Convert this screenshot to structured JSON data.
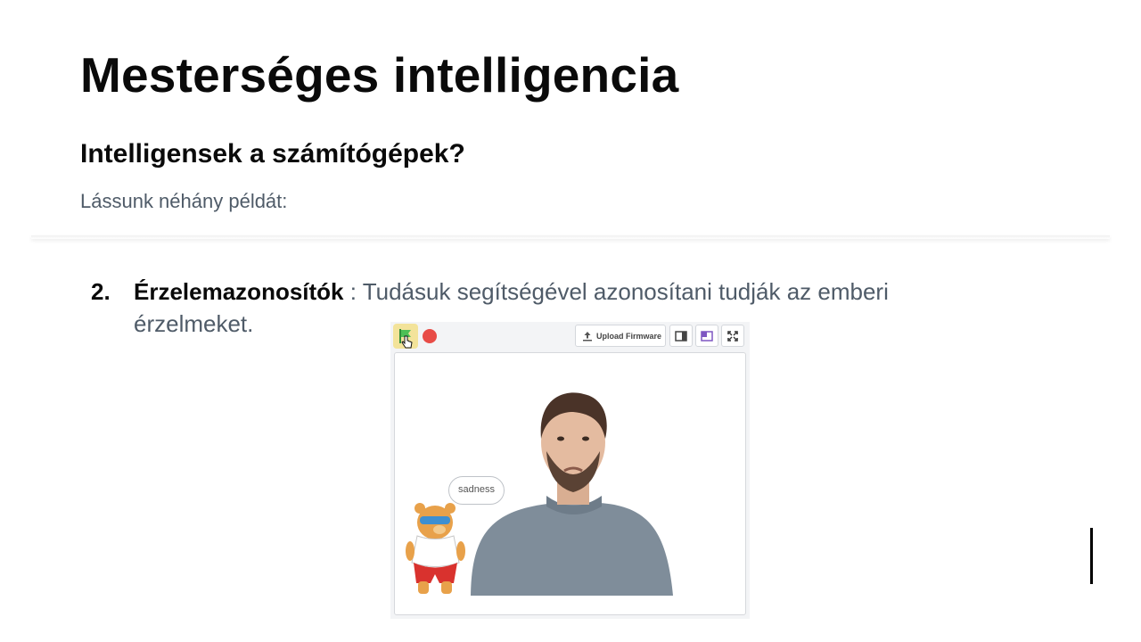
{
  "slide": {
    "title": "Mesterséges intelligencia",
    "subtitle": "Intelligensek a számítógépek?",
    "lead": "Lássunk néhány példát:"
  },
  "item": {
    "number": "2.",
    "term": "Érzelemazonosítók",
    "description": " : Tudásuk segítségével azonosítani tudják az emberi érzelmeket."
  },
  "demo": {
    "toolbar": {
      "upload_label": "Upload Firmware",
      "icons": [
        "green-flag-icon",
        "stop-icon",
        "upload-icon",
        "small-stage-icon",
        "large-stage-icon",
        "fullscreen-icon"
      ]
    },
    "speech_bubble": "sadness",
    "colors": {
      "flag": "#4cbf56",
      "stop": "#e84c47",
      "accent": "#7e57c2"
    }
  }
}
